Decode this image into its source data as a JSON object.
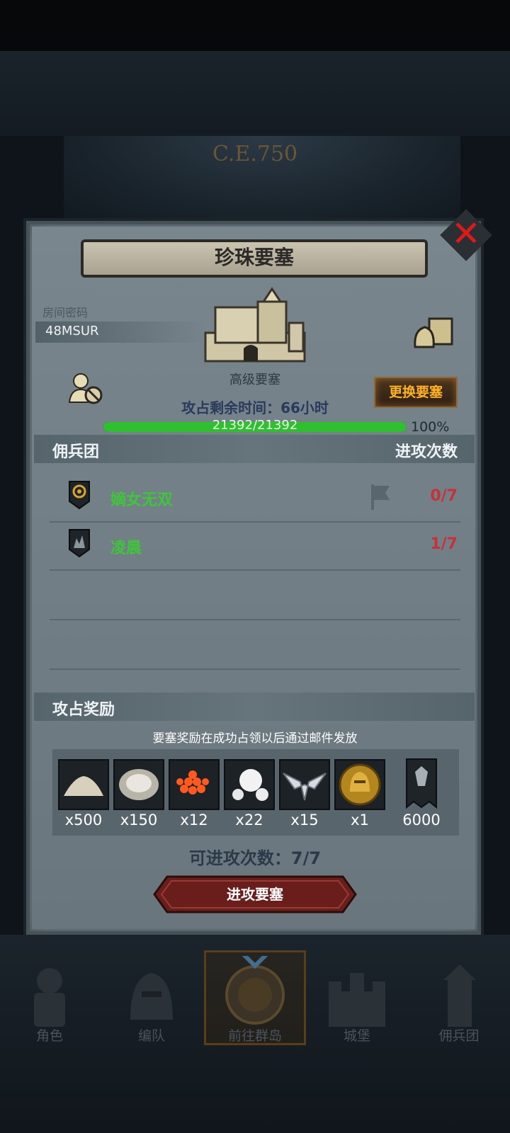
{
  "background": {
    "era_label": "C.E.750"
  },
  "panel": {
    "title": "珍珠要塞",
    "room_code_label": "房间密码",
    "room_code": "48MSUR",
    "fortress_type": "高级要塞",
    "change_button": "更换要塞",
    "remaining_time": "攻占剩余时间：66小时",
    "hp_text": "21392/21392",
    "hp_fraction": 1.0,
    "hp_percent": "100%"
  },
  "mercenary_section": {
    "title": "佣兵团",
    "attacks_header": "进攻次数",
    "rows": [
      {
        "name": "嫡女无双",
        "count": "0/7"
      },
      {
        "name": "凌晨",
        "count": "1/7"
      }
    ]
  },
  "rewards_section": {
    "title": "攻占奖励",
    "note": "要塞奖励在成功占领以后通过邮件发放",
    "items": [
      {
        "icon": "sand-pile-icon",
        "qty": "x500"
      },
      {
        "icon": "oyster-shell-icon",
        "qty": "x150"
      },
      {
        "icon": "fish-roe-icon",
        "qty": "x12"
      },
      {
        "icon": "pearls-icon",
        "qty": "x22"
      },
      {
        "icon": "silver-wings-emblem-icon",
        "qty": "x15"
      },
      {
        "icon": "gold-helmet-coin-icon",
        "qty": "x1"
      },
      {
        "icon": "war-banner-icon",
        "qty": "6000"
      }
    ]
  },
  "attack": {
    "available": "可进攻次数：7/7",
    "button_label": "进攻要塞"
  },
  "bottom_nav": {
    "tabs": [
      {
        "label": "角色"
      },
      {
        "label": "编队"
      },
      {
        "label": "前往群岛"
      },
      {
        "label": "城堡"
      },
      {
        "label": "佣兵团"
      }
    ]
  },
  "colors": {
    "panel": "#6c7880",
    "guild_name": "#3ec53a",
    "count_red": "#c8303a",
    "hp_green": "#2ec12e",
    "button_gold": "#ffb21e",
    "close_red": "#e01818"
  }
}
